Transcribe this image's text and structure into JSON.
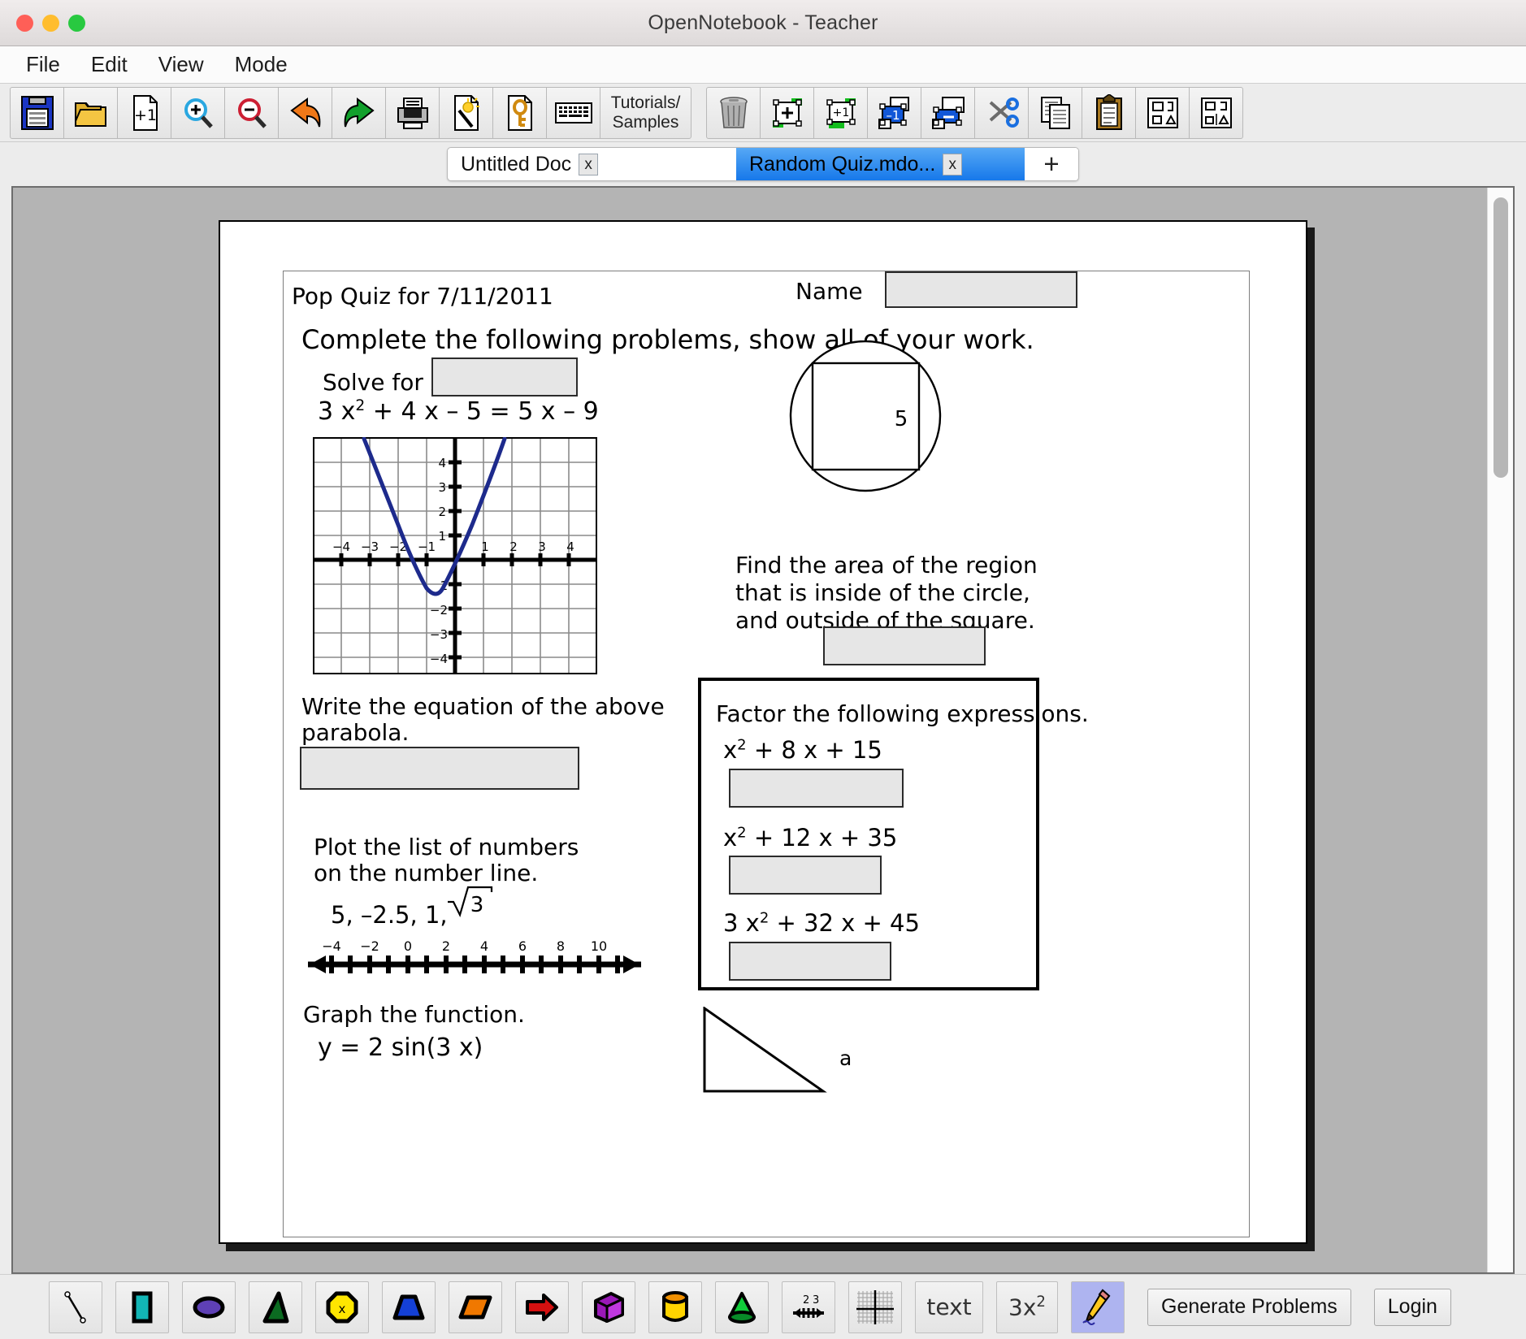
{
  "window": {
    "title": "OpenNotebook - Teacher"
  },
  "menubar": {
    "items": [
      "File",
      "Edit",
      "View",
      "Mode"
    ]
  },
  "toolbar": {
    "group1": [
      {
        "name": "save-icon",
        "label": ""
      },
      {
        "name": "open-folder-icon",
        "label": ""
      },
      {
        "name": "new-page-icon",
        "label": "+1"
      },
      {
        "name": "zoom-in-icon",
        "label": ""
      },
      {
        "name": "zoom-out-icon",
        "label": ""
      },
      {
        "name": "undo-icon",
        "label": ""
      },
      {
        "name": "redo-icon",
        "label": ""
      },
      {
        "name": "print-icon",
        "label": ""
      },
      {
        "name": "generate-page-icon",
        "label": ""
      },
      {
        "name": "answer-key-icon",
        "label": ""
      },
      {
        "name": "keyboard-icon",
        "label": ""
      },
      {
        "name": "tutorials-samples-button",
        "label": "Tutorials/\nSamples"
      }
    ],
    "group2": [
      {
        "name": "delete-trash-icon",
        "label": ""
      },
      {
        "name": "add-group-icon",
        "label": ""
      },
      {
        "name": "add-one-group-icon",
        "label": ""
      },
      {
        "name": "remove-one-icon",
        "label": ""
      },
      {
        "name": "remove-group-icon",
        "label": ""
      },
      {
        "name": "cut-scissors-icon",
        "label": ""
      },
      {
        "name": "copy-icon",
        "label": ""
      },
      {
        "name": "paste-clipboard-icon",
        "label": ""
      },
      {
        "name": "align-icon",
        "label": ""
      },
      {
        "name": "distribute-icon",
        "label": ""
      }
    ],
    "tutorials_label_line1": "Tutorials/",
    "tutorials_label_line2": "Samples"
  },
  "tabs": {
    "items": [
      {
        "label": "Untitled Doc",
        "close": "x",
        "active": false
      },
      {
        "label": "Random Quiz.mdo...",
        "close": "x",
        "active": true
      }
    ],
    "add_label": "+"
  },
  "document": {
    "title": "Pop Quiz for 7/11/2011",
    "name_label": "Name",
    "instructions": "Complete the following problems, show all of your work.",
    "q1": {
      "prompt": "Solve for x.",
      "equation_lead": "3 x",
      "equation_sup": "2",
      "equation_rest": " + 4 x – 5 = 5 x – 9"
    },
    "q2": {
      "prompt_line1": "Write the equation of the above",
      "prompt_line2": "parabola."
    },
    "q3": {
      "prompt_line1": "Plot the list of numbers",
      "prompt_line2": "on the number line.",
      "numbers": "5, –2.5, 1,",
      "radicand": "3"
    },
    "q4": {
      "prompt": "Graph the function.",
      "function": "y = 2 sin(3 x)"
    },
    "q5": {
      "square_label": "5",
      "prompt_line1": "Find the area of the region",
      "prompt_line2": "that is inside of the circle,",
      "prompt_line3": "and outside of the square."
    },
    "q6": {
      "heading": "Factor the following expressions.",
      "expressions": [
        {
          "lead": "x",
          "sup": "2",
          "rest": " + 8 x + 15"
        },
        {
          "lead": "x",
          "sup": "2",
          "rest": " + 12 x + 35"
        },
        {
          "lead": "3 x",
          "sup": "2",
          "rest": " + 32 x + 45"
        }
      ]
    },
    "q7": {
      "side_label": "a"
    }
  },
  "chart_data": {
    "type": "line",
    "title": "",
    "xlabel": "",
    "ylabel": "",
    "xlim": [
      -5,
      5
    ],
    "ylim": [
      -5,
      5
    ],
    "grid": true,
    "xticks": [
      -4,
      -3,
      -2,
      -1,
      1,
      2,
      3,
      4
    ],
    "yticks": [
      4,
      3,
      2,
      1,
      -1,
      -2,
      -3,
      -4
    ],
    "series": [
      {
        "name": "parabola",
        "color": "#1d2a8c",
        "expression": "y = x^2 + 2x - 0.2",
        "x": [
          -3.1,
          -3.0,
          -2.5,
          -2.0,
          -1.5,
          -1.0,
          -0.5,
          0.0,
          0.5,
          1.0,
          1.1
        ],
        "y": [
          4.4,
          2.8,
          0.05,
          -1.0,
          -1.45,
          -1.2,
          -0.95,
          -0.2,
          1.05,
          2.8,
          4.4
        ]
      }
    ]
  },
  "numberline": {
    "labels": [
      "–4",
      "–2",
      "0",
      "2",
      "4",
      "6",
      "8",
      "10"
    ],
    "values": [
      -4,
      -2,
      0,
      2,
      4,
      6,
      8,
      10
    ],
    "min": -5.5,
    "max": 12.0
  },
  "bottombar": {
    "tools": [
      {
        "name": "line-tool-icon",
        "label": ""
      },
      {
        "name": "rectangle-tool-icon",
        "label": ""
      },
      {
        "name": "ellipse-tool-icon",
        "label": ""
      },
      {
        "name": "triangle-tool-icon",
        "label": ""
      },
      {
        "name": "octagon-tool-icon",
        "label": ""
      },
      {
        "name": "trapezoid-tool-icon",
        "label": ""
      },
      {
        "name": "parallelogram-tool-icon",
        "label": ""
      },
      {
        "name": "arrow-tool-icon",
        "label": ""
      },
      {
        "name": "cube-tool-icon",
        "label": ""
      },
      {
        "name": "cylinder-tool-icon",
        "label": ""
      },
      {
        "name": "cone-tool-icon",
        "label": ""
      },
      {
        "name": "numberline-tool-icon",
        "label": "2 3"
      },
      {
        "name": "grid-tool-icon",
        "label": ""
      },
      {
        "name": "text-tool-icon",
        "label": "text"
      },
      {
        "name": "expression-tool-icon",
        "label": "3x2"
      },
      {
        "name": "pencil-tool-icon",
        "label": ""
      }
    ],
    "expression_label_lead": "3x",
    "expression_label_sup": "2",
    "text_label": "text",
    "numberline_label": "2 3",
    "generate_problems": "Generate Problems",
    "login": "Login"
  },
  "colors": {
    "accent_tab": "#1678ea",
    "parabola": "#1d2a8c",
    "answer_field": "#e6e6e6",
    "window_chrome": "#ececec"
  }
}
